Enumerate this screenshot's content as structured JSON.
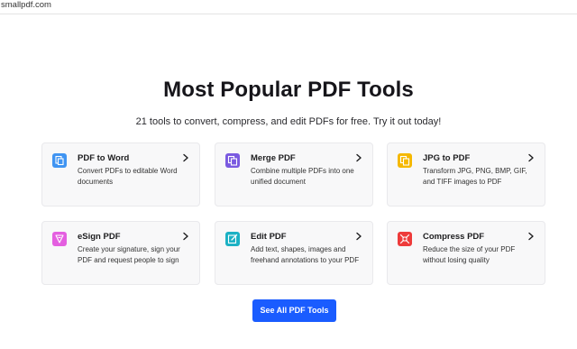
{
  "browser": {
    "url": "smallpdf.com"
  },
  "hero": {
    "title": "Most Popular PDF Tools",
    "subtitle": "21 tools to convert, compress, and edit PDFs for free. Try it out today!"
  },
  "tools": [
    {
      "name": "PDF to Word",
      "desc": "Convert PDFs to editable Word documents",
      "icon": "word-icon",
      "color": "#3f94f2"
    },
    {
      "name": "Merge PDF",
      "desc": "Combine multiple PDFs into one unified document",
      "icon": "merge-icon",
      "color": "#7a5ae0"
    },
    {
      "name": "JPG to PDF",
      "desc": "Transform JPG, PNG, BMP, GIF, and TIFF images to PDF",
      "icon": "image-icon",
      "color": "#f5b800"
    },
    {
      "name": "eSign PDF",
      "desc": "Create your signature, sign your PDF and request people to sign",
      "icon": "esign-icon",
      "color": "#e45fe0"
    },
    {
      "name": "Edit PDF",
      "desc": "Add text, shapes, images and freehand annotations to your PDF",
      "icon": "edit-icon",
      "color": "#1bb1c4"
    },
    {
      "name": "Compress PDF",
      "desc": "Reduce the size of your PDF without losing quality",
      "icon": "compress-icon",
      "color": "#ee3b3b"
    }
  ],
  "cta": {
    "label": "See All PDF Tools",
    "color": "#1a5cff"
  }
}
